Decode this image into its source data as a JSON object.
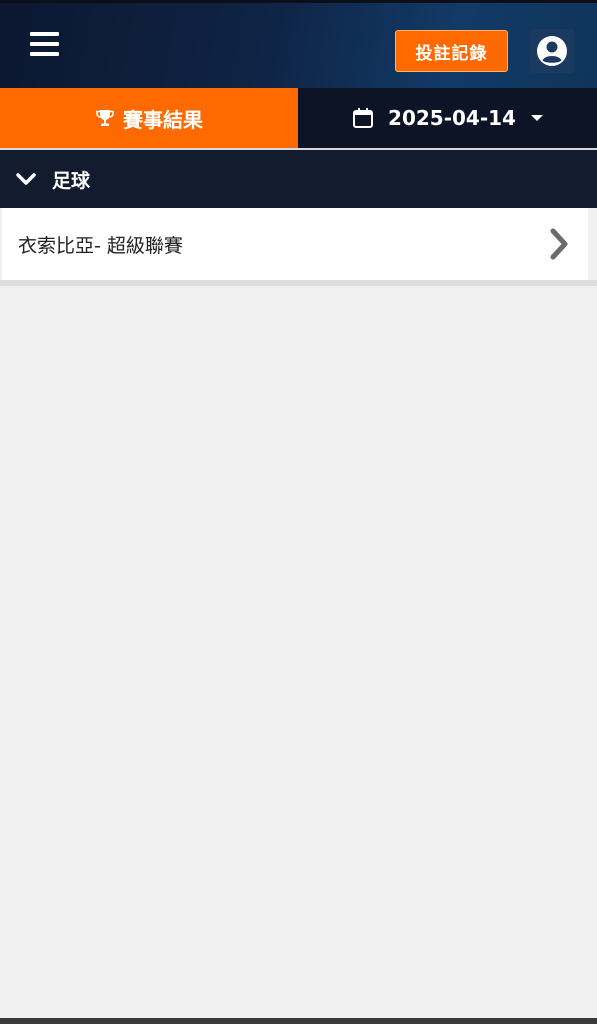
{
  "header": {
    "bet_record_label": "投註記錄",
    "menu_icon": "hamburger-menu-icon",
    "account_icon": "user-circle-icon"
  },
  "tabs": {
    "results_label": "賽事結果",
    "results_icon": "trophy-icon",
    "date_value": "2025-04-14",
    "date_icon": "calendar-icon",
    "date_caret_icon": "caret-down-icon"
  },
  "sport_section": {
    "label": "足球",
    "expand_icon": "chevron-down-icon"
  },
  "leagues": [
    {
      "name": "衣索比亞- 超級聯賽",
      "icon": "chevron-right-icon"
    }
  ],
  "colors": {
    "accent_orange": "#ff6a00",
    "header_navy": "#0f2446",
    "tab_dark": "#0d1426",
    "section_dark": "#131c2f",
    "page_bg": "#f0f0f0"
  }
}
